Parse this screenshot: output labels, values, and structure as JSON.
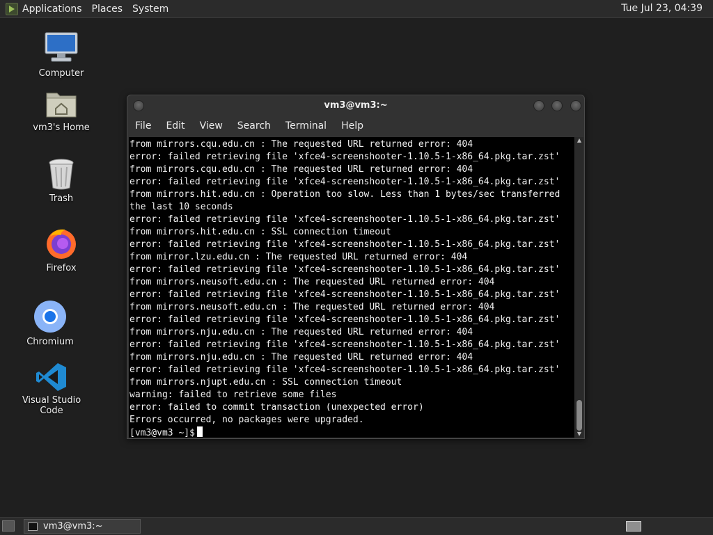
{
  "top_panel": {
    "menus": [
      "Applications",
      "Places",
      "System"
    ],
    "clock": "Tue Jul 23, 04:39"
  },
  "desktop_icons": [
    {
      "label": "Computer",
      "icon": "computer-icon"
    },
    {
      "label": "vm3's Home",
      "icon": "home-folder-icon"
    },
    {
      "label": "Trash",
      "icon": "trash-icon"
    },
    {
      "label": "Firefox",
      "icon": "firefox-icon"
    },
    {
      "label": "Chromium",
      "icon": "chromium-icon"
    },
    {
      "label": "Visual Studio Code",
      "icon": "vscode-icon"
    }
  ],
  "terminal": {
    "title": "vm3@vm3:~",
    "menu": [
      "File",
      "Edit",
      "View",
      "Search",
      "Terminal",
      "Help"
    ],
    "lines": [
      "from mirrors.cqu.edu.cn : The requested URL returned error: 404",
      "error: failed retrieving file 'xfce4-screenshooter-1.10.5-1-x86_64.pkg.tar.zst'",
      "from mirrors.cqu.edu.cn : The requested URL returned error: 404",
      "error: failed retrieving file 'xfce4-screenshooter-1.10.5-1-x86_64.pkg.tar.zst'",
      "from mirrors.hit.edu.cn : Operation too slow. Less than 1 bytes/sec transferred",
      "the last 10 seconds",
      "error: failed retrieving file 'xfce4-screenshooter-1.10.5-1-x86_64.pkg.tar.zst'",
      "from mirrors.hit.edu.cn : SSL connection timeout",
      "error: failed retrieving file 'xfce4-screenshooter-1.10.5-1-x86_64.pkg.tar.zst'",
      "from mirror.lzu.edu.cn : The requested URL returned error: 404",
      "error: failed retrieving file 'xfce4-screenshooter-1.10.5-1-x86_64.pkg.tar.zst'",
      "from mirrors.neusoft.edu.cn : The requested URL returned error: 404",
      "error: failed retrieving file 'xfce4-screenshooter-1.10.5-1-x86_64.pkg.tar.zst'",
      "from mirrors.neusoft.edu.cn : The requested URL returned error: 404",
      "error: failed retrieving file 'xfce4-screenshooter-1.10.5-1-x86_64.pkg.tar.zst'",
      "from mirrors.nju.edu.cn : The requested URL returned error: 404",
      "error: failed retrieving file 'xfce4-screenshooter-1.10.5-1-x86_64.pkg.tar.zst'",
      "from mirrors.nju.edu.cn : The requested URL returned error: 404",
      "error: failed retrieving file 'xfce4-screenshooter-1.10.5-1-x86_64.pkg.tar.zst'",
      "from mirrors.njupt.edu.cn : SSL connection timeout",
      "warning: failed to retrieve some files",
      "error: failed to commit transaction (unexpected error)",
      "Errors occurred, no packages were upgraded."
    ],
    "prompt": "[vm3@vm3 ~]$"
  },
  "taskbar": {
    "items": [
      "vm3@vm3:~"
    ]
  }
}
